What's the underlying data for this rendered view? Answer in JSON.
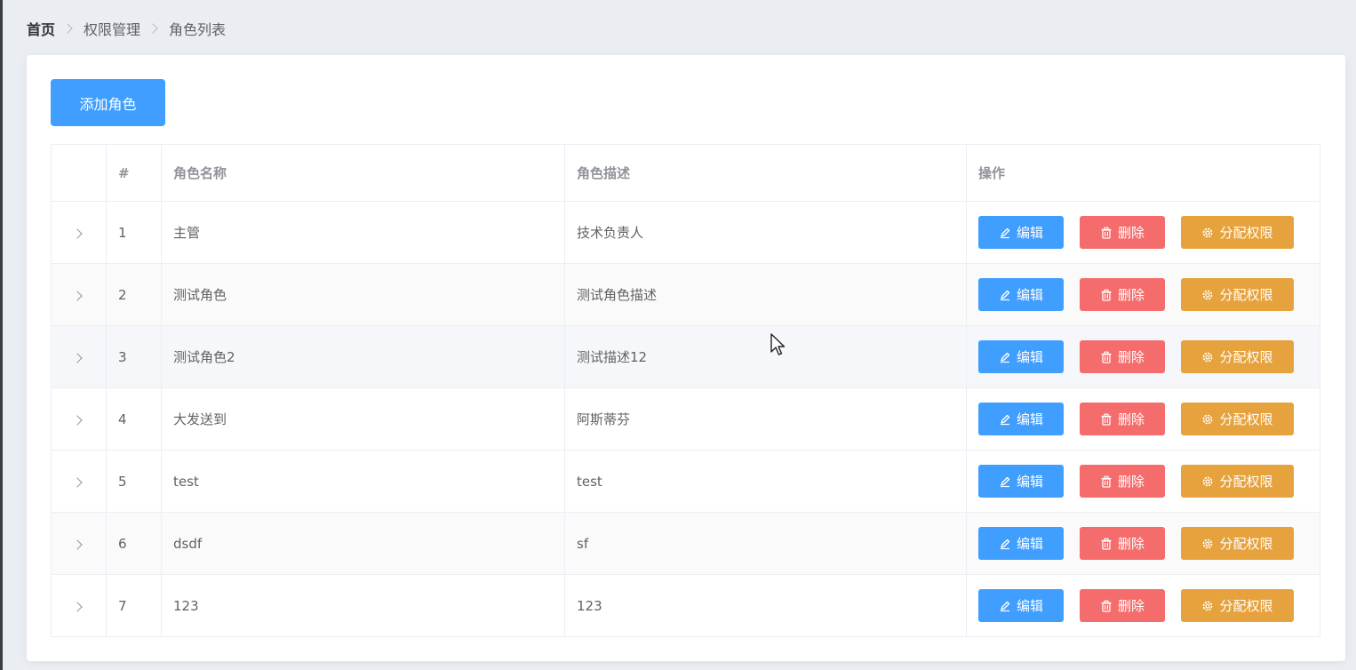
{
  "breadcrumb": {
    "home": "首页",
    "level1": "权限管理",
    "level2": "角色列表"
  },
  "toolbar": {
    "add_label": "添加角色"
  },
  "table": {
    "headers": {
      "index": "#",
      "name": "角色名称",
      "desc": "角色描述",
      "ops": "操作"
    },
    "rows": [
      {
        "index": "1",
        "name": "主管",
        "desc": "技术负责人"
      },
      {
        "index": "2",
        "name": "测试角色",
        "desc": "测试角色描述"
      },
      {
        "index": "3",
        "name": "测试角色2",
        "desc": "测试描述12"
      },
      {
        "index": "4",
        "name": "大发送到",
        "desc": "阿斯蒂芬"
      },
      {
        "index": "5",
        "name": "test",
        "desc": "test"
      },
      {
        "index": "6",
        "name": "dsdf",
        "desc": "sf"
      },
      {
        "index": "7",
        "name": "123",
        "desc": "123"
      }
    ],
    "actions": {
      "edit": "编辑",
      "delete": "删除",
      "assign": "分配权限"
    }
  },
  "icons": {
    "expand": "chevron-right-icon",
    "edit": "edit-icon",
    "delete": "delete-icon",
    "assign": "setting-icon",
    "separator": "chevron-right-icon"
  },
  "colors": {
    "primary": "#409eff",
    "danger": "#f56c6c",
    "warning": "#e6a23c",
    "page_bg": "#eaedf1"
  }
}
